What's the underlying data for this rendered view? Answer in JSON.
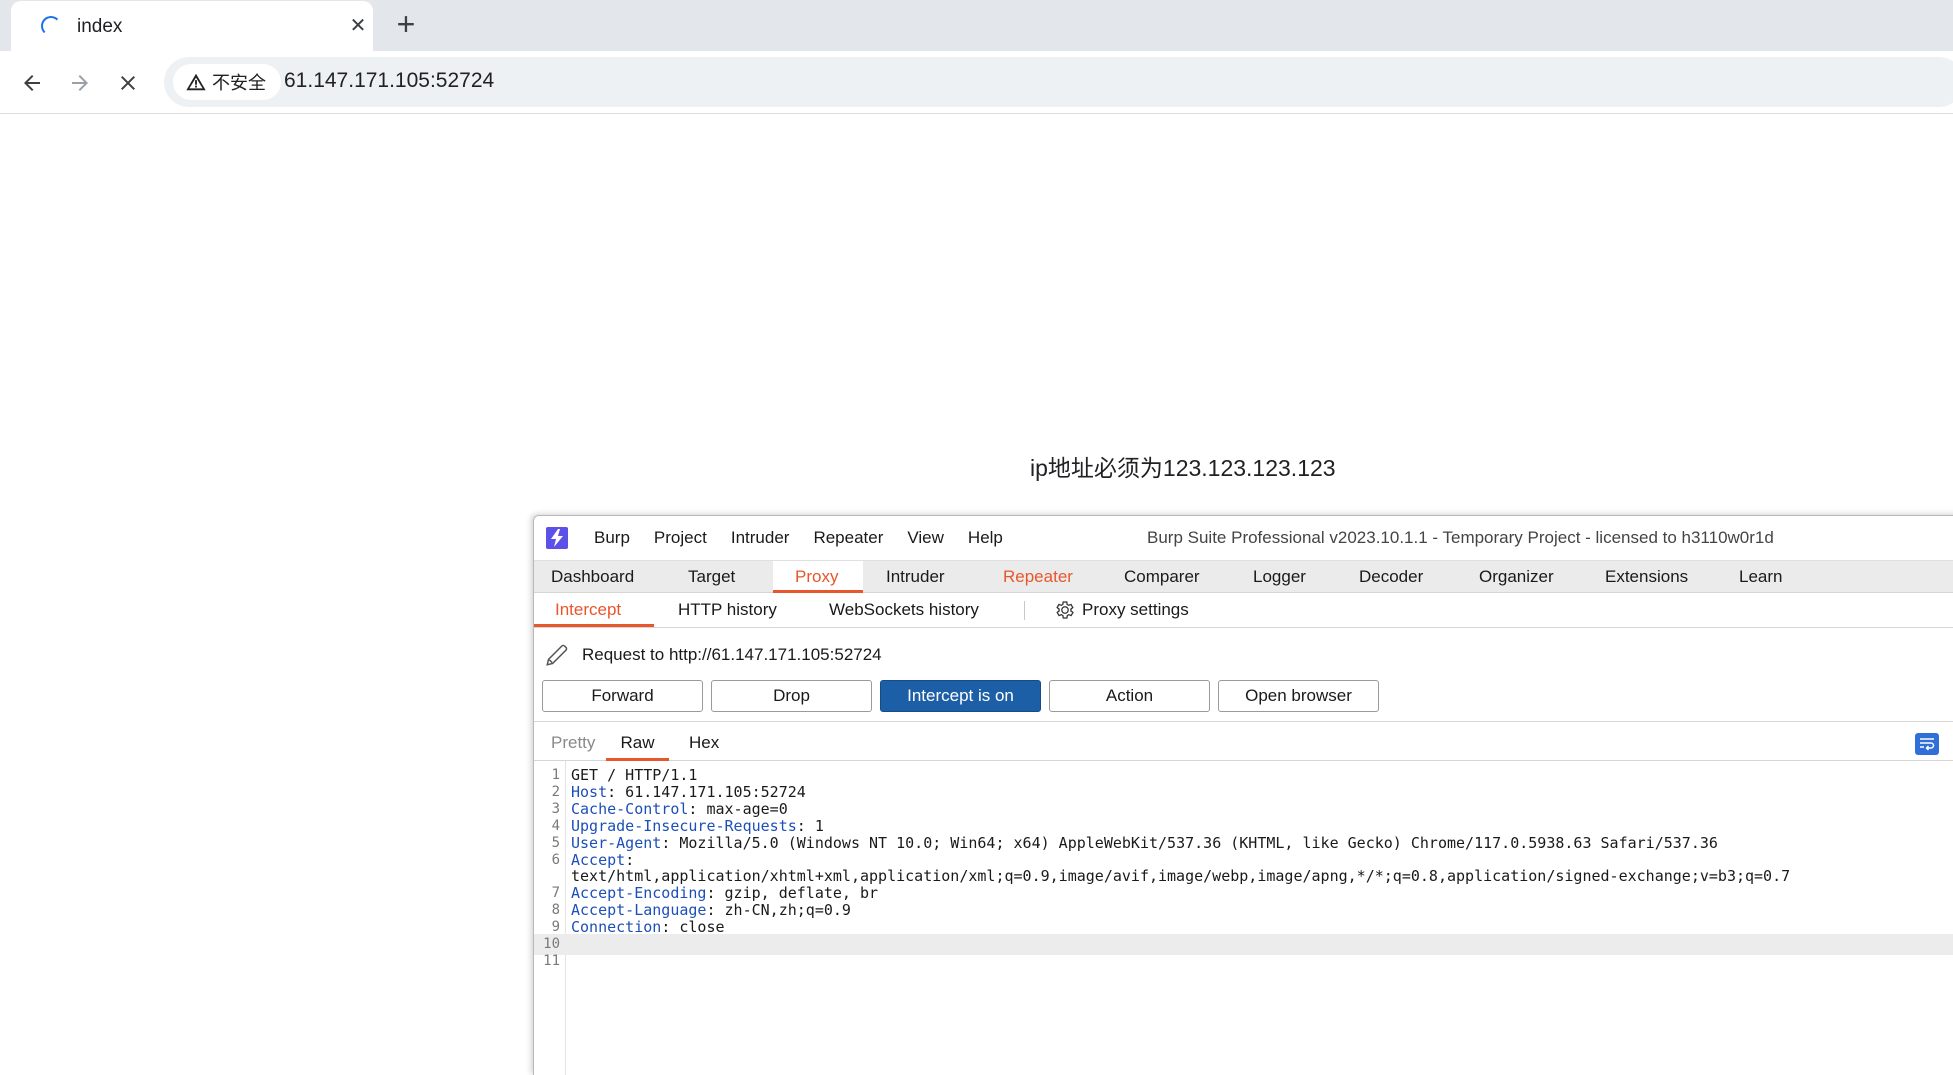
{
  "browser": {
    "tab": {
      "title": "index",
      "close_glyph": "✕"
    },
    "new_tab_glyph": "+",
    "security_label": "不安全",
    "url": "61.147.171.105:52724"
  },
  "page": {
    "message": "ip地址必须为123.123.123.123"
  },
  "burp": {
    "menu": [
      "Burp",
      "Project",
      "Intruder",
      "Repeater",
      "View",
      "Help"
    ],
    "title": "Burp Suite Professional v2023.10.1.1 - Temporary Project - licensed to h3110w0r1d",
    "main_tabs": [
      "Dashboard",
      "Target",
      "Proxy",
      "Intruder",
      "Repeater",
      "Comparer",
      "Logger",
      "Decoder",
      "Organizer",
      "Extensions",
      "Learn"
    ],
    "active_main_tab": "Proxy",
    "sub_tabs": [
      "Intercept",
      "HTTP history",
      "WebSockets history"
    ],
    "active_sub_tab": "Intercept",
    "proxy_settings_label": "Proxy settings",
    "request_line": "Request to http://61.147.171.105:52724",
    "buttons": {
      "forward": "Forward",
      "drop": "Drop",
      "intercept": "Intercept is on",
      "action": "Action",
      "open_browser": "Open browser"
    },
    "editor_tabs": [
      "Pretty",
      "Raw",
      "Hex"
    ],
    "active_editor_tab": "Raw",
    "request": [
      {
        "num": "1",
        "name": "",
        "value": "GET / HTTP/1.1"
      },
      {
        "num": "2",
        "name": "Host",
        "value": ": 61.147.171.105:52724"
      },
      {
        "num": "3",
        "name": "Cache-Control",
        "value": ": max-age=0"
      },
      {
        "num": "4",
        "name": "Upgrade-Insecure-Requests",
        "value": ": 1"
      },
      {
        "num": "5",
        "name": "User-Agent",
        "value": ": Mozilla/5.0 (Windows NT 10.0; Win64; x64) AppleWebKit/537.36 (KHTML, like Gecko) Chrome/117.0.5938.63 Safari/537.36"
      },
      {
        "num": "6",
        "name": "Accept",
        "value": ":"
      },
      {
        "num": "",
        "name": "",
        "value": "text/html,application/xhtml+xml,application/xml;q=0.9,image/avif,image/webp,image/apng,*/*;q=0.8,application/signed-exchange;v=b3;q=0.7"
      },
      {
        "num": "7",
        "name": "Accept-Encoding",
        "value": ": gzip, deflate, br"
      },
      {
        "num": "8",
        "name": "Accept-Language",
        "value": ": zh-CN,zh;q=0.9"
      },
      {
        "num": "9",
        "name": "Connection",
        "value": ": close"
      },
      {
        "num": "10",
        "name": "",
        "value": ""
      },
      {
        "num": "11",
        "name": "",
        "value": ""
      }
    ],
    "colors": {
      "accent": "#e8572c",
      "primary_button": "#1d5fa6",
      "header_name": "#1d4fb8",
      "logo": "#5b50e8"
    }
  }
}
